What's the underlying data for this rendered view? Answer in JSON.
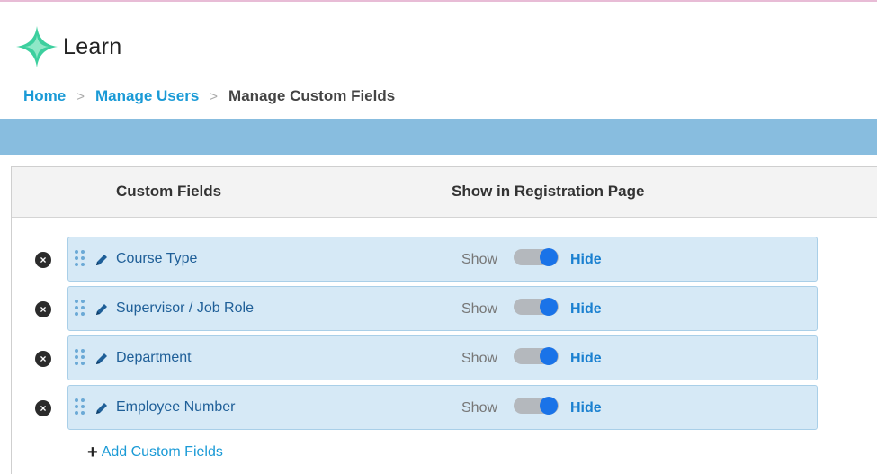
{
  "app": {
    "logo_text": "Learn"
  },
  "breadcrumb": {
    "home": "Home",
    "sep": ">",
    "manage_users": "Manage Users",
    "current": "Manage Custom Fields"
  },
  "table": {
    "col_fields": "Custom Fields",
    "col_show": "Show in Registration Page"
  },
  "rows": [
    {
      "name": "Course Type",
      "show": "Show",
      "hide": "Hide"
    },
    {
      "name": "Supervisor / Job Role",
      "show": "Show",
      "hide": "Hide"
    },
    {
      "name": "Department",
      "show": "Show",
      "hide": "Hide"
    },
    {
      "name": "Employee Number",
      "show": "Show",
      "hide": "Hide"
    }
  ],
  "add_button": {
    "label": "Add Custom Fields",
    "icon": "+"
  },
  "icons": {
    "remove": "×"
  },
  "colors": {
    "accent": "#1a9ad6",
    "band": "#88bddf",
    "row_bg": "#d6e9f6",
    "logo": "#3ccf9e"
  }
}
